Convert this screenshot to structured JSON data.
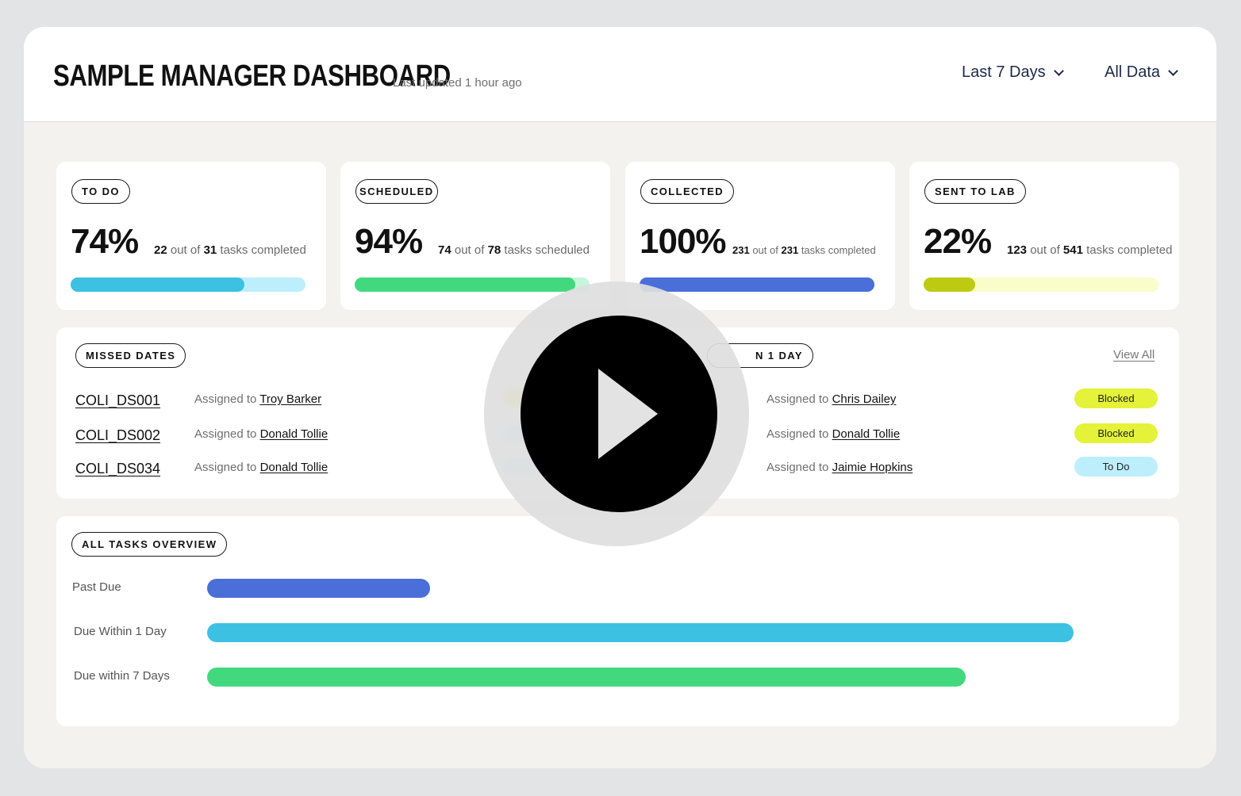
{
  "header": {
    "title": "SAMPLE MANAGER DASHBOARD",
    "updated": "Last updated 1 hour ago",
    "filter_range": "Last 7 Days",
    "filter_data": "All Data"
  },
  "stats": [
    {
      "label": "TO DO",
      "percent": "74%",
      "done": "22",
      "of": "out of",
      "total": "31",
      "suffix": "tasks completed",
      "fraction": 0.74,
      "color": "#3cc1e3",
      "track": "#bdeefc"
    },
    {
      "label": "SCHEDULED",
      "percent": "94%",
      "done": "74",
      "of": "out of",
      "total": "78",
      "suffix": "tasks scheduled",
      "fraction": 0.94,
      "color": "#42d97e",
      "track": "#c7f5d9"
    },
    {
      "label": "COLLECTED",
      "percent": "100%",
      "done": "231",
      "of": "out of",
      "total": "231",
      "suffix": "tasks completed",
      "fraction": 1.0,
      "color": "#4a6fd9",
      "track": "#c9d5f6"
    },
    {
      "label": "SENT TO LAB",
      "percent": "22%",
      "done": "123",
      "of": "out of",
      "total": "541",
      "suffix": "tasks completed",
      "fraction": 0.22,
      "color": "#bccb11",
      "track": "#f8fdc9"
    }
  ],
  "missed": {
    "label": "MISSED DATES",
    "rows": [
      {
        "id": "COLI_DS001",
        "assigned": "Assigned to",
        "name": "Troy Barker"
      },
      {
        "id": "COLI_DS002",
        "assigned": "Assigned to",
        "name": "Donald Tollie"
      },
      {
        "id": "COLI_DS034",
        "assigned": "Assigned to",
        "name": "Donald Tollie"
      }
    ]
  },
  "due": {
    "label": "N 1 DAY",
    "view_all": "View All",
    "rows": [
      {
        "assigned": "Assigned to",
        "name": "Chris Dailey",
        "status": "Blocked",
        "status_color": "#e4f23a"
      },
      {
        "assigned": "Assigned to",
        "name": "Donald Tollie",
        "status": "Blocked",
        "status_color": "#e4f23a"
      },
      {
        "assigned": "Assigned to",
        "name": "Jaimie Hopkins",
        "status": "To Do",
        "status_color": "#bdeefc"
      }
    ]
  },
  "overview": {
    "label": "ALL TASKS OVERVIEW",
    "bars": [
      {
        "label": "Past Due",
        "fraction": 0.257,
        "color": "#4a6fd9"
      },
      {
        "label": "Due Within 1 Day",
        "fraction": 1.0,
        "color": "#3cc1e3"
      },
      {
        "label": "Due within 7 Days",
        "fraction": 0.875,
        "color": "#42d97e"
      }
    ]
  },
  "icons": {
    "play": "play-icon",
    "dropdown": "chevron-down-icon"
  }
}
